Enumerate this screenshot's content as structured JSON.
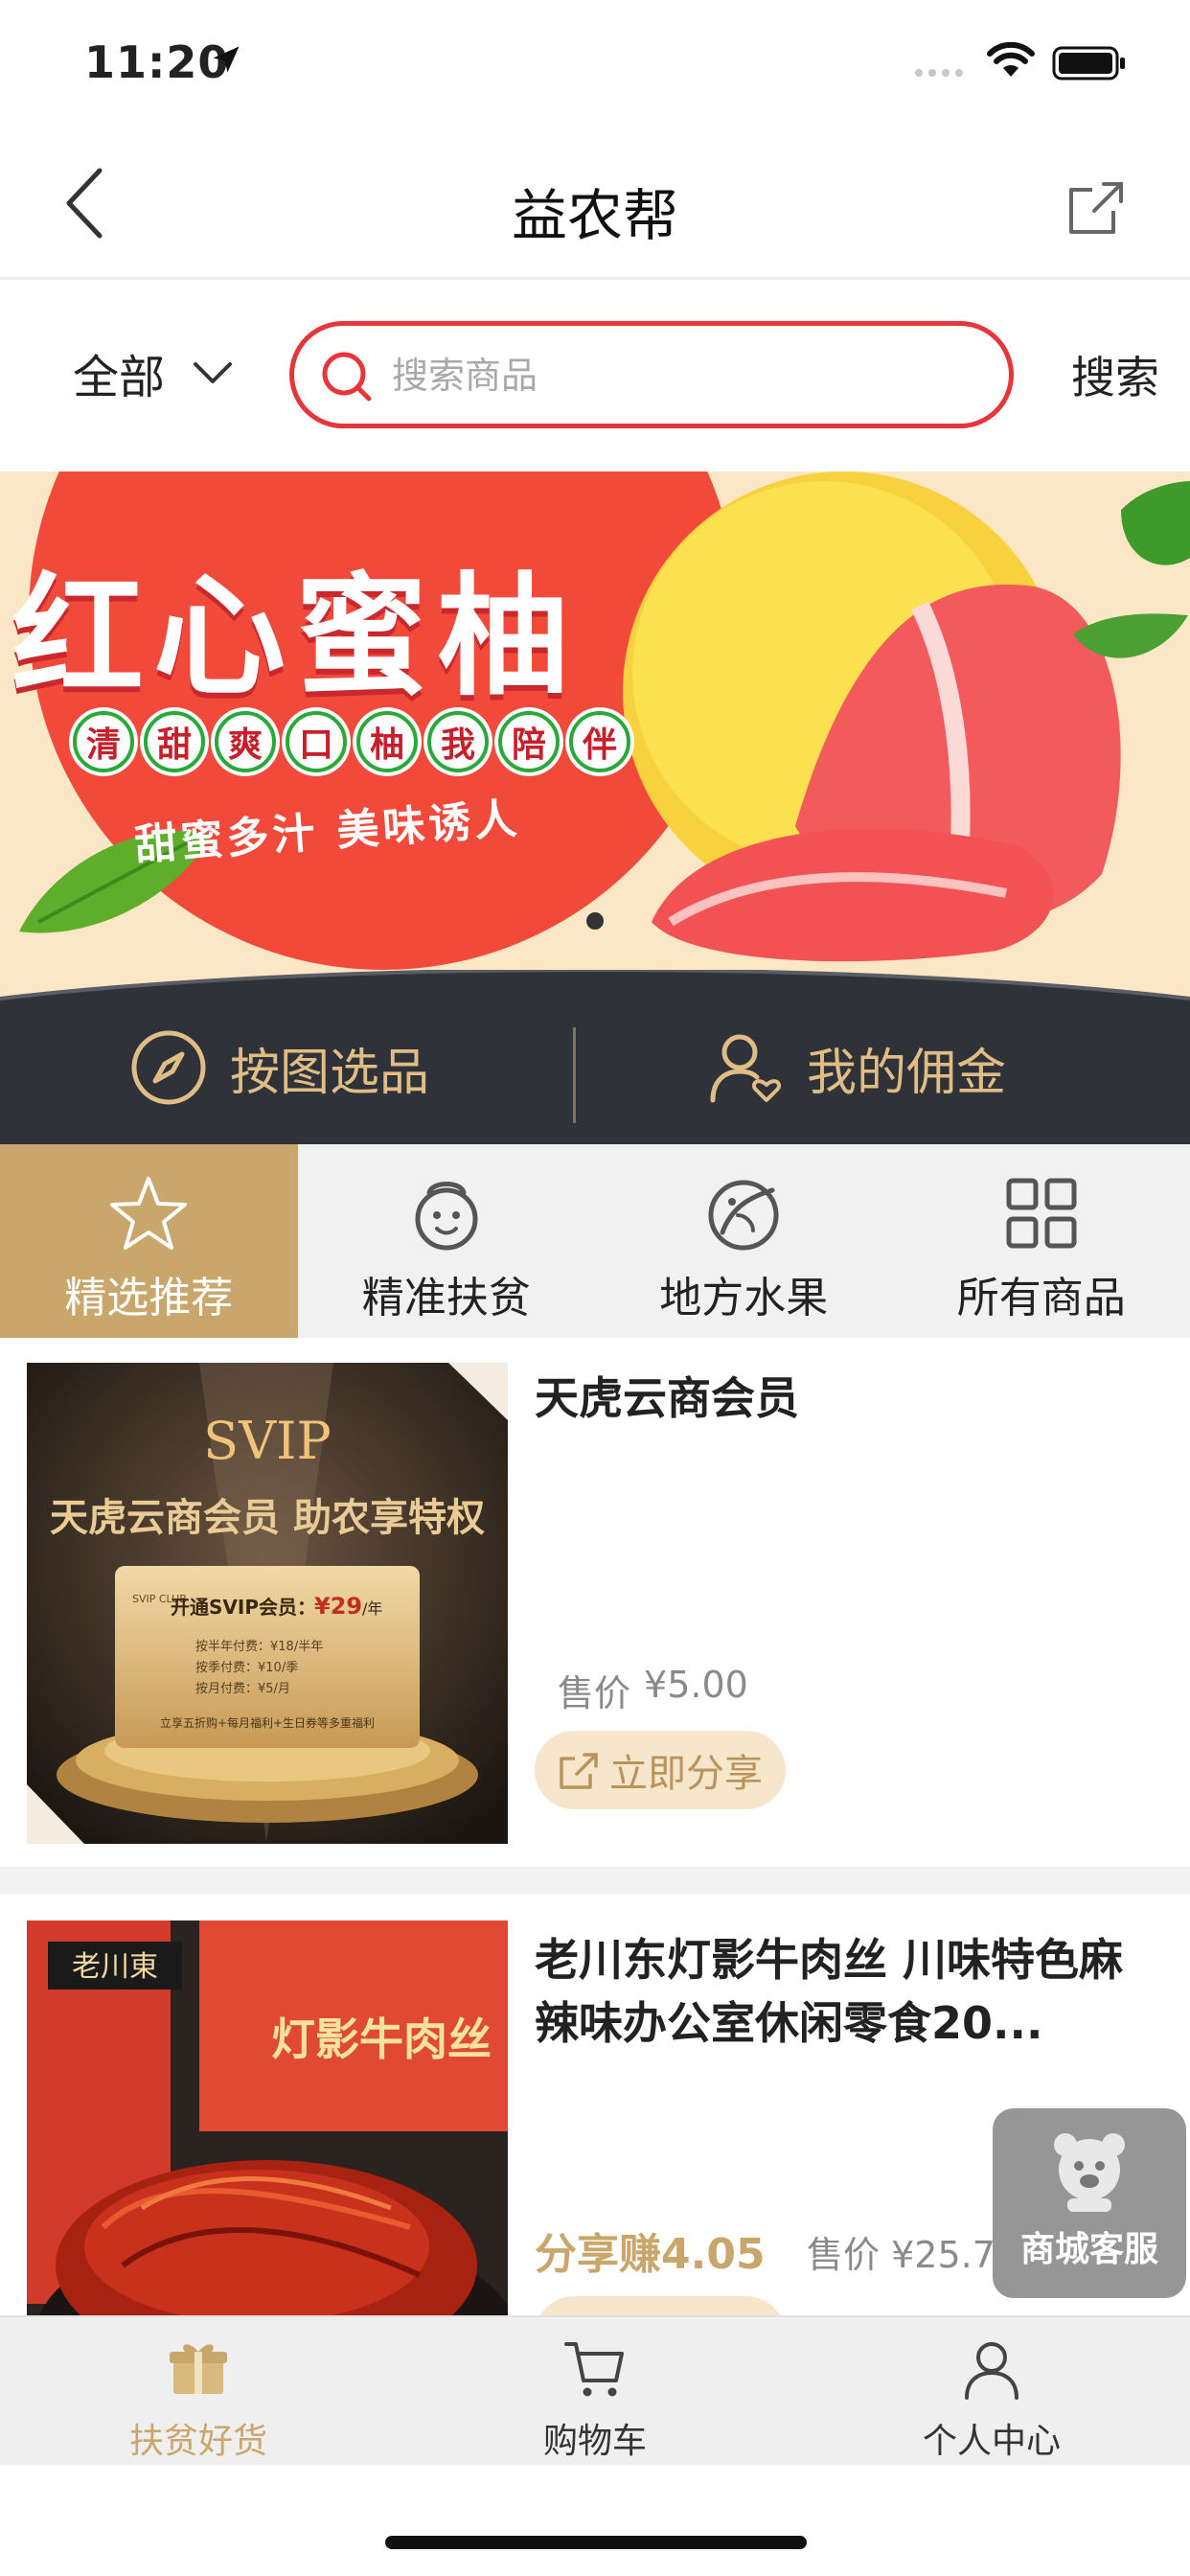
{
  "status_bar": {
    "time": "11:20"
  },
  "nav": {
    "title": "益农帮"
  },
  "search": {
    "category": "全部",
    "placeholder": "搜索商品",
    "value": "",
    "button": "搜索"
  },
  "banner": {
    "title": "红心蜜柚",
    "tags": [
      "清",
      "甜",
      "爽",
      "口",
      "柚",
      "我",
      "陪",
      "伴"
    ],
    "slogan": "甜蜜多汁 美味诱人"
  },
  "gold_bar": {
    "left_label": "按图选品",
    "right_label": "我的佣金"
  },
  "tabs": [
    {
      "label": "精选推荐",
      "icon": "star-icon",
      "active": true
    },
    {
      "label": "精准扶贫",
      "icon": "face-icon",
      "active": false
    },
    {
      "label": "地方水果",
      "icon": "fruit-icon",
      "active": false
    },
    {
      "label": "所有商品",
      "icon": "grid-icon",
      "active": false
    }
  ],
  "products": [
    {
      "name": "天虎云商会员",
      "price_label": "售价",
      "price": "¥5.00",
      "share_label": "立即分享",
      "thumb": {
        "brand": "SVIP",
        "headline": "天虎云商会员 助农享特权",
        "card_title": "开通SVIP会员：",
        "card_price": "¥29",
        "card_unit": "/年",
        "card_line1": "按半年付费：¥18/半年",
        "card_line2": "按季付费：¥10/季",
        "card_line3": "按月付费：¥5/月",
        "card_footer": "立享五折购+每月福利+生日券等多重福利",
        "badge": "SVIP CLUB"
      }
    },
    {
      "name": "老川东灯影牛肉丝 川味特色麻辣味办公室休闲零食20...",
      "earn_label": "分享赚4.05",
      "price_label": "售价",
      "price": "¥25.7",
      "thumb": {
        "brand": "老川東",
        "package_text": "灯影牛肉丝"
      }
    }
  ],
  "service": {
    "label": "商城客服"
  },
  "tabbar": [
    {
      "label": "扶贫好货",
      "icon": "gift-icon",
      "active": true
    },
    {
      "label": "购物车",
      "icon": "cart-icon",
      "active": false
    },
    {
      "label": "个人中心",
      "icon": "person-icon",
      "active": false
    }
  ],
  "colors": {
    "accent_red": "#e7363a",
    "gold": "#c9a66b",
    "dark_bar": "#2f3238"
  }
}
